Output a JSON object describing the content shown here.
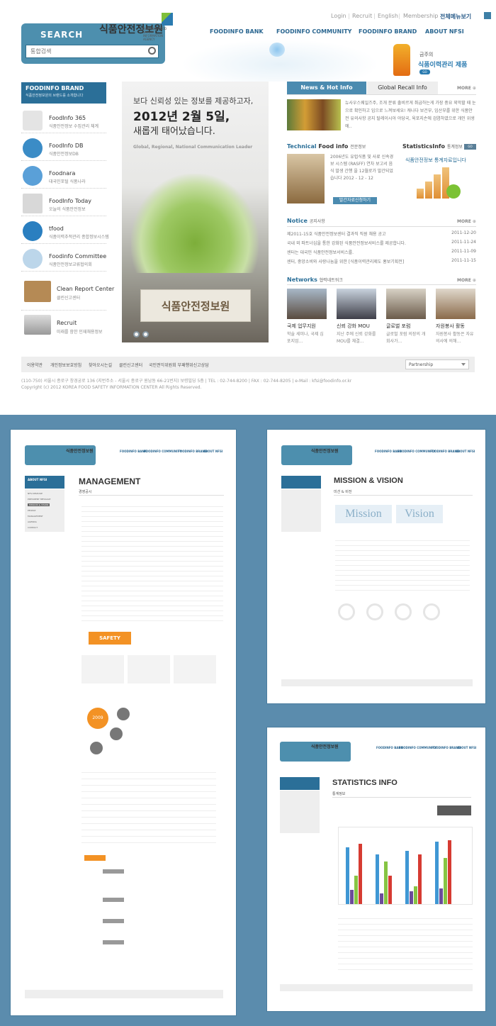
{
  "header": {
    "search_title": "SEARCH",
    "search_placeholder": "통합검색",
    "logo_text": "식품안전정보원",
    "logo_sub": "NATIONAL FOOD SAFETY INFORMATION AGENCY",
    "util": [
      "Login",
      "Recruit",
      "English",
      "Membership"
    ],
    "all_menu": "전체메뉴보기",
    "gnb": [
      "FOODINFO BANK",
      "FOODINFO COMMUNITY",
      "FOODINFO BRAND",
      "ABOUT NFSI"
    ],
    "ad_sub": "금주의",
    "ad_title": "식품이력관리 제품",
    "ad_go": "GO"
  },
  "brand": {
    "title": "FOODINFO BRAND",
    "sub": "식품안전정보원의 브랜드를 소개합니다",
    "items": [
      {
        "name": "FoodInfo 365",
        "desc": "식품안전정보 수집관리 체계",
        "icon": "calendar-icon"
      },
      {
        "name": "FoodInfo DB",
        "desc": "식품안전정보DB",
        "icon": "database-icon"
      },
      {
        "name": "Foodnara",
        "desc": "대국민포털 식품나라",
        "icon": "globe-icon"
      },
      {
        "name": "FoodInfo Today",
        "desc": "오늘의 식품안전정보",
        "icon": "news-icon"
      },
      {
        "name": "tfood",
        "desc": "식품이력추적관리 종합정보시스템",
        "icon": "trace-icon"
      },
      {
        "name": "Foodinfo Committee",
        "desc": "식품안전정보교류협의회",
        "icon": "committee-icon"
      },
      {
        "name": "Clean Report Center",
        "desc": "클린신고센터",
        "icon": "folder-icon"
      },
      {
        "name": "Recruit",
        "desc": "미래를 함한 인재채용정보",
        "icon": "recruit-icon"
      }
    ]
  },
  "banner": {
    "line1": "보다 신뢰성 있는 정보를 제공하고자,",
    "line2": "2012년 2월 5일,",
    "line3": "새롭게 태어났습니다.",
    "line4": "Global, Regional, National Communication Leader",
    "sign": "식품안전정보원"
  },
  "news": {
    "tab_active": "News & Hot Info",
    "tab_other": "Global Recall Info",
    "more": "MORE",
    "text": "뉴사우스웨일즈주, 조개 분류 출비르게 취급하는게 가장 중요 외막할 때 눈으로 확인하고 입으로 느껴보세요! 캐나다 보건부, 임산부를 위한 식품안전 유의사항 공지 탈레이시아 야당국, 육포지손에 검염하였으로 개인 위생에.."
  },
  "technical": {
    "title_hl": "Technical",
    "title_rest": " Food info",
    "sub": "전문정보",
    "text": "2006년도 유럽식품 및 사료 신속경보 시스템 (RASFF) 연차 보고서 음식 발생 간행 을 12월로가 발간되었습니다 2012 - 12 - 12",
    "button": "발간자료신청하기"
  },
  "statistics": {
    "title": "StatisticsInfo",
    "sub": "통계정보",
    "caption": "식품안전정보 통계자료입니다"
  },
  "notice": {
    "title_hl": "Notice",
    "sub": "공지사항",
    "more": "MORE",
    "rows": [
      {
        "text": "제2011-15호 식품안전정보센터 결과직 직원 채용 공고",
        "date": "2011-12-20"
      },
      {
        "text": "국내 외 파트너십을 통한 강화된 식품안전정보서비스를 제공합니다.",
        "date": "2011-11-24"
      },
      {
        "text": "센터는 대국민 식품안전정보서비스를.",
        "date": "2011-11-09"
      },
      {
        "text": "센터, 중앙소비와 사랑나눔을 위한 [식품이력관리제도 홍보기획전]",
        "date": "2011-11-15"
      }
    ]
  },
  "networks": {
    "title_hl": "Networks",
    "sub": "협력네트워크",
    "more": "MORE",
    "items": [
      {
        "title": "국제 업무지원",
        "desc": "학술 세미나, 국제 심포지엄..."
      },
      {
        "title": "신뢰 강화 MOU",
        "desc": "지난 주에 신뢰 강화를 MOU를 체결..."
      },
      {
        "title": "글로벌 포럼",
        "desc": "글로벌 포럼 의장의 개회사가..."
      },
      {
        "title": "자원봉사 활동",
        "desc": "자원봉사 활동은 자유의사에 의해..."
      }
    ]
  },
  "footer": {
    "links": [
      "이용약관",
      "개인정보보호방침",
      "찾아오시는길",
      "클린신고센터",
      "국민권익위원회 부패행위신고상담"
    ],
    "partnership": "Partnership",
    "address": "(110-750) 서울시 종로구 창경궁로 136 (지번주소 - 서울시 종로구 원남동 66-21번지) 보령빌딩 5층  |  TEL : 02-744-8200  |  FAX : 02-744-8205  |  e-Mail : kfsi@foodinfo.or.kr",
    "copyright": "Copyright (c) 2012 KOREA FOOD SAFETY INFORMATION CENTER All Rights Reserved."
  },
  "subpages": {
    "management": {
      "title": "MANAGEMENT",
      "sub": "경영공시",
      "side_head": "ABOUT NFSI",
      "side_items": [
        "NFSI RELEASE",
        "PRESIDENT MESSAGE",
        "MISSION & VISION",
        "PEOPLE",
        "MANAGEMENT",
        "AGENDA",
        "CONTACT"
      ],
      "safety": "SAFETY",
      "year": "2009"
    },
    "mission": {
      "title": "MISSION & VISION",
      "sub": "미션 & 비전",
      "mission": "Mission",
      "vision": "Vision"
    },
    "statistics": {
      "title": "STATISTICS INFO",
      "sub": "통계정보"
    }
  },
  "colors": {
    "accent": "#2b6f98",
    "frame": "#5b8cad",
    "tab": "#4b8bb0"
  }
}
